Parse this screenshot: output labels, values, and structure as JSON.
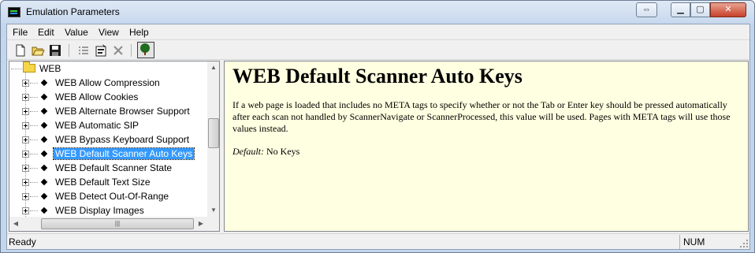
{
  "window": {
    "title": "Emulation Parameters"
  },
  "menu": [
    "File",
    "Edit",
    "Value",
    "View",
    "Help"
  ],
  "toolbar": {
    "buttons": [
      "new-file-icon",
      "open-folder-icon",
      "save-icon",
      "list-icon",
      "properties-icon",
      "delete-icon",
      "tree-icon"
    ]
  },
  "tree": {
    "root": "WEB",
    "items": [
      "WEB Allow Compression",
      "WEB Allow Cookies",
      "WEB Alternate Browser Support",
      "WEB Automatic SIP",
      "WEB Bypass Keyboard Support",
      "WEB Default Scanner Auto Keys",
      "WEB Default Scanner State",
      "WEB Default Text Size",
      "WEB Detect Out-Of-Range",
      "WEB Display Images"
    ],
    "selected_index": 5
  },
  "detail": {
    "heading": "WEB Default Scanner Auto Keys",
    "body": "If a web page is loaded that includes no META tags to specify whether or not the Tab or Enter key should be pressed automatically after each scan not handled by ScannerNavigate or ScannerProcessed, this value will be used.  Pages with META tags will use those values instead.",
    "default_label": "Default:",
    "default_value": "No Keys"
  },
  "status": {
    "text": "Ready",
    "num": "NUM"
  }
}
